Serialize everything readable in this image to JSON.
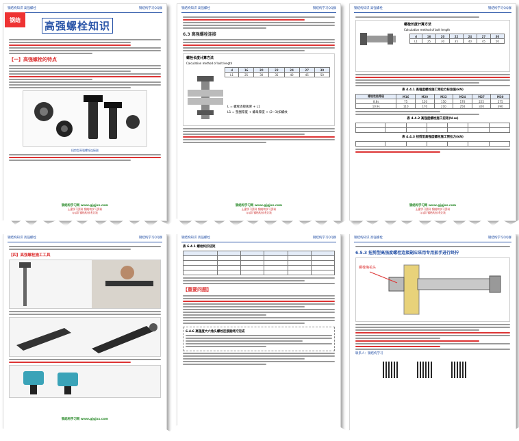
{
  "header": {
    "left": "钢结构知识 高强螺栓",
    "right": "钢结构学习QQ群"
  },
  "page1": {
    "logo_text": "钢结",
    "title": "高强螺栓知识",
    "section_heading": "【一】高强螺栓的特点",
    "image_caption": "扭剪型高强螺栓连接副"
  },
  "page2": {
    "section_heading": "6.3 高强螺栓连接",
    "calc_title": "螺栓长度计算方法",
    "calc_subtitle": "Calculation method of bolt length",
    "calc_table": {
      "header": [
        "d",
        "16",
        "20",
        "22",
        "24",
        "27",
        "30"
      ],
      "row": [
        "L1",
        "25",
        "30",
        "35",
        "40",
        "45",
        "50"
      ]
    },
    "formula1": "L = 螺栓连接板厚 + L1",
    "formula2": "L1 = 垫圈厚度 + 螺母厚度 + (2~3)扣螺纹"
  },
  "page3": {
    "calc_title": "螺栓长度计算方法",
    "calc_subtitle": "Calculation method of bolt length",
    "calc_table": {
      "header": [
        "d",
        "16",
        "20",
        "22",
        "24",
        "27",
        "30"
      ],
      "row": [
        "L1",
        "25",
        "30",
        "35",
        "40",
        "45",
        "50"
      ]
    },
    "table2_title": "表 4.4.1 高强度螺栓施工预拉力标准值(kN)",
    "table2_header": [
      "螺栓性能等级",
      "M16",
      "M20",
      "M22",
      "M24",
      "M27",
      "M30"
    ],
    "table2_rows": [
      [
        "8.8s",
        "75",
        "120",
        "150",
        "170",
        "225",
        "275"
      ],
      [
        "10.9s",
        "110",
        "170",
        "210",
        "250",
        "320",
        "390"
      ]
    ],
    "table3_title": "表 4.4.2 高强度螺栓施工扭矩(N·m)",
    "table4_title": "表 4.4.3 扭剪型高强度螺栓施工预拉力(kN)"
  },
  "page4": {
    "section_heading": "【四】高强螺栓施工工具"
  },
  "page5": {
    "table_title": "表 6.4.1 螺栓终拧扭矩",
    "section_heading": "【重要问题】",
    "subheading": "6.4.6 高强度大六角头螺栓连接副终拧完成"
  },
  "page6": {
    "section_heading": "6.5.3 扭剪型高强度螺栓连接副应采用专用扳手进行终拧",
    "image_label": "螺栓梅花头",
    "contact": "联系人：钢结构学习"
  },
  "footer": {
    "site": "钢结构学习网 www.gjgjxx.com",
    "line1": "土建学习资料 钢结构学习资料",
    "line2": "QQ群 钢结构技术交流"
  },
  "colors": {
    "accent": "#2a55a8",
    "red": "#d33333",
    "green": "#2a8a2a"
  }
}
